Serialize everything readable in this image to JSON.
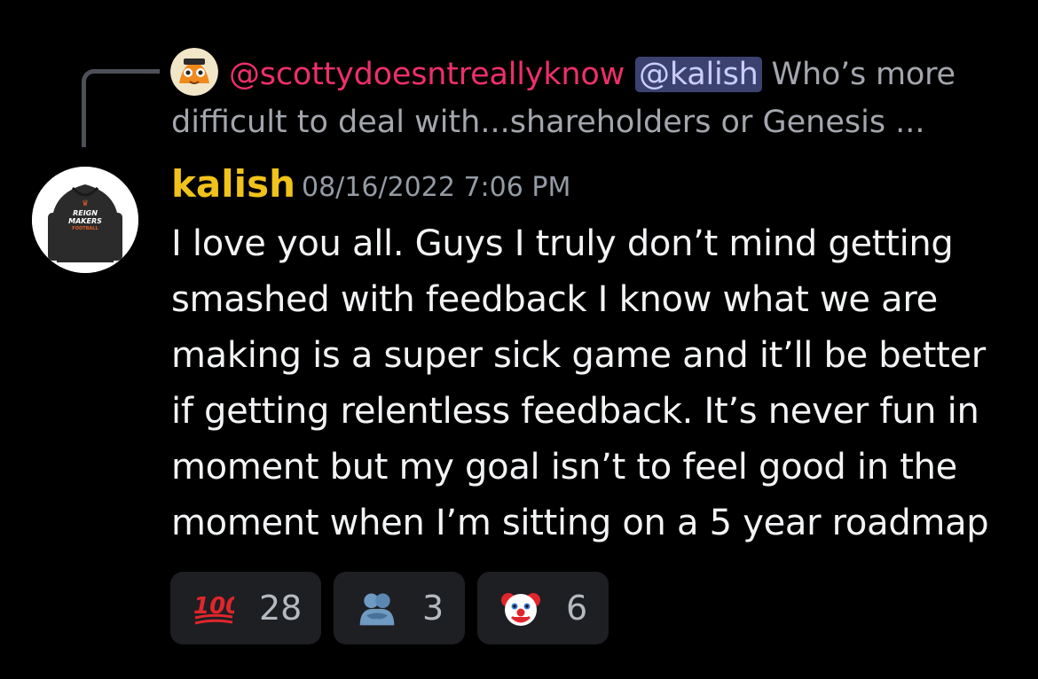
{
  "reply": {
    "author": "@scottydoesntreallyknow",
    "mention": "@kalish",
    "text_line1": "Who’s more",
    "text_line2": "difficult to deal with...shareholders or Genesis ...",
    "avatar_icon": "orange-fox-mascot-icon"
  },
  "message": {
    "author": "kalish",
    "author_color": "#f0c21b",
    "timestamp": "08/16/2022 7:06 PM",
    "avatar_icon": "reignmakers-hoodie-avatar",
    "avatar_text_1": "REIGN",
    "avatar_text_2": "MAKERS",
    "avatar_text_3": "FOOTBALL",
    "body": "I love you all.  Guys I truly don’t mind getting\nsmashed with feedback I know what we are\nmaking is a super sick game and it’ll be better\nif getting relentless feedback.  It’s never fun in\nmoment but my goal isn’t to feel good in the\nmoment when I’m sitting on a 5 year roadmap"
  },
  "reactions": [
    {
      "emoji": "hundred-points-icon",
      "count": "28"
    },
    {
      "emoji": "people-hugging-icon",
      "count": "3"
    },
    {
      "emoji": "clown-face-icon",
      "count": "6"
    }
  ],
  "colors": {
    "background": "#000000",
    "reply_author": "#ee2f6a",
    "mention_bg": "#3c4270",
    "reaction_bg": "#1e1f22"
  }
}
